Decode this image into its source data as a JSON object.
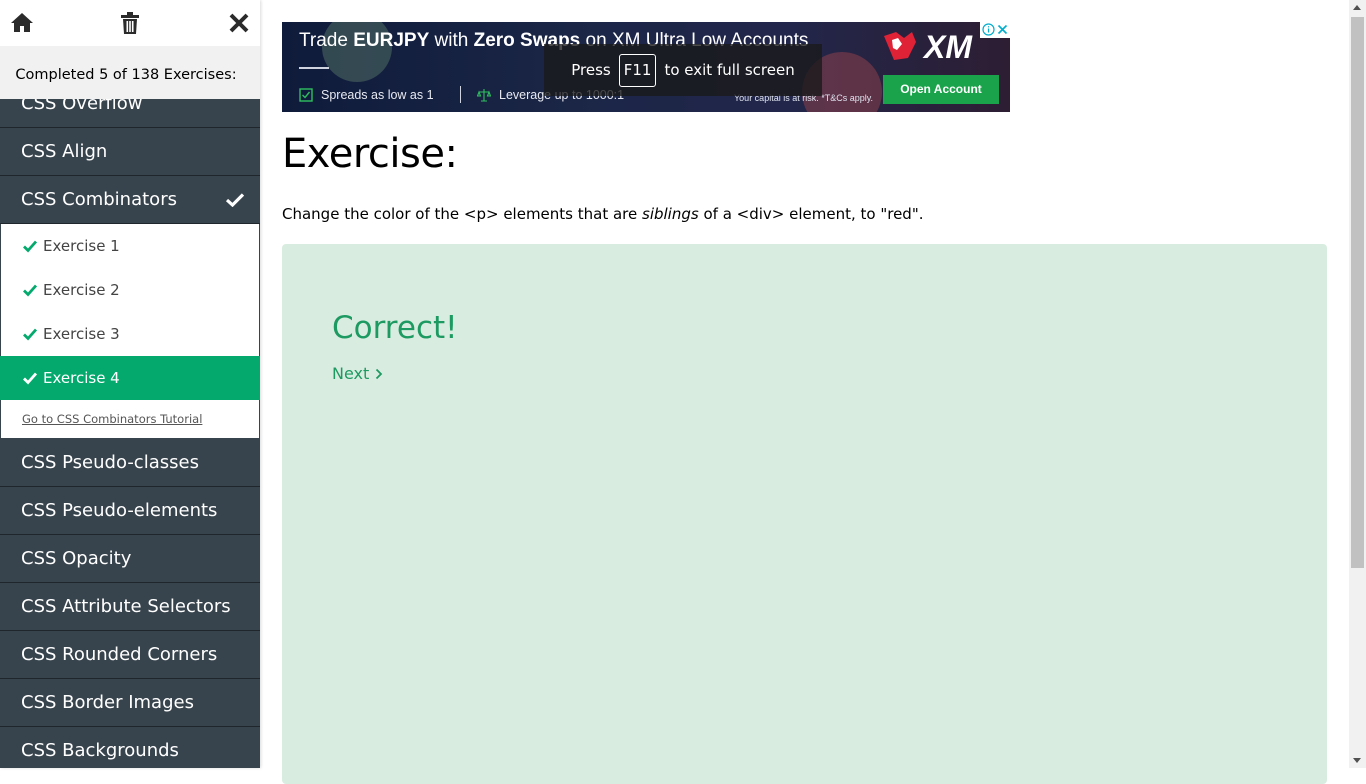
{
  "sidebar": {
    "progress_text": "Completed 5 of 138 Exercises:",
    "categories_top": [
      {
        "label": "CSS Overflow"
      },
      {
        "label": "CSS Align"
      },
      {
        "label": "CSS Combinators",
        "completed": true
      }
    ],
    "exercises": [
      {
        "label": "Exercise 1",
        "done": true
      },
      {
        "label": "Exercise 2",
        "done": true
      },
      {
        "label": "Exercise 3",
        "done": true
      },
      {
        "label": "Exercise 4",
        "done": true,
        "active": true
      }
    ],
    "tutorial_link": "Go to CSS Combinators Tutorial",
    "categories_bottom": [
      {
        "label": "CSS Pseudo-classes"
      },
      {
        "label": "CSS Pseudo-elements"
      },
      {
        "label": "CSS Opacity"
      },
      {
        "label": "CSS Attribute Selectors"
      },
      {
        "label": "CSS Rounded Corners"
      },
      {
        "label": "CSS Border Images"
      },
      {
        "label": "CSS Backgrounds"
      }
    ]
  },
  "ad": {
    "headline_pre": "Trade ",
    "headline_b1": "EURJPY",
    "headline_mid": " with ",
    "headline_b2": "Zero Swaps",
    "headline_post": " on XM Ultra Low Accounts",
    "feature1": "Spreads as low as 1",
    "feature2": "Leverage up to 1000:1",
    "disclaimer": "Your capital is at risk. *T&Cs apply.",
    "button": "Open Account",
    "logo_text": "XM"
  },
  "fullscreen_notice": {
    "pre": "Press",
    "key": "F11",
    "post": "to exit full screen"
  },
  "main": {
    "title": "Exercise:",
    "instruction_pre": "Change the color of the <p> elements that are ",
    "instruction_em": "siblings",
    "instruction_post": " of a <div> element, to \"red\".",
    "result_title": "Correct!",
    "next_label": "Next"
  },
  "colors": {
    "accent": "#04aa6d",
    "sidebar_bg": "#38444d",
    "result_bg": "#d9ece0",
    "result_text": "#1d9a62"
  }
}
